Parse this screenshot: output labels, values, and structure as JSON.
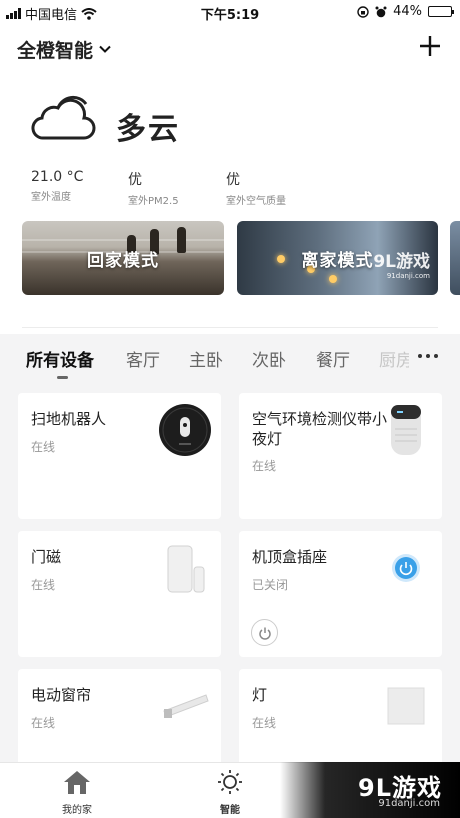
{
  "status_bar": {
    "carrier": "中国电信",
    "time": "下午5:19",
    "battery": "44%"
  },
  "header": {
    "home_name": "全橙智能"
  },
  "weather": {
    "condition": "多云",
    "metrics": [
      {
        "value": "21.0 °C",
        "label": "室外温度"
      },
      {
        "value": "优",
        "label": "室外PM2.5"
      },
      {
        "value": "优",
        "label": "室外空气质量"
      }
    ]
  },
  "scenes": [
    {
      "label": "回家模式"
    },
    {
      "label": "离家模式"
    }
  ],
  "watermark": {
    "brand": "9L游戏",
    "url": "91danji.com"
  },
  "tabs": [
    "所有设备",
    "客厅",
    "主卧",
    "次卧",
    "餐厅",
    "厨房"
  ],
  "devices": [
    {
      "name": "扫地机器人",
      "status": "在线"
    },
    {
      "name": "空气环境检测仪带小夜灯",
      "status": "在线"
    },
    {
      "name": "门磁",
      "status": "在线"
    },
    {
      "name": "机顶盒插座",
      "status": "已关闭"
    },
    {
      "name": "电动窗帘",
      "status": "在线"
    },
    {
      "name": "灯",
      "status": "在线"
    }
  ],
  "bottom_nav": [
    {
      "label": "我的家",
      "icon": "home-icon"
    },
    {
      "label": "智能",
      "icon": "sun-icon"
    }
  ],
  "colors": {
    "accent_blue": "#3aa0e8",
    "background": "#f4f4f5"
  }
}
